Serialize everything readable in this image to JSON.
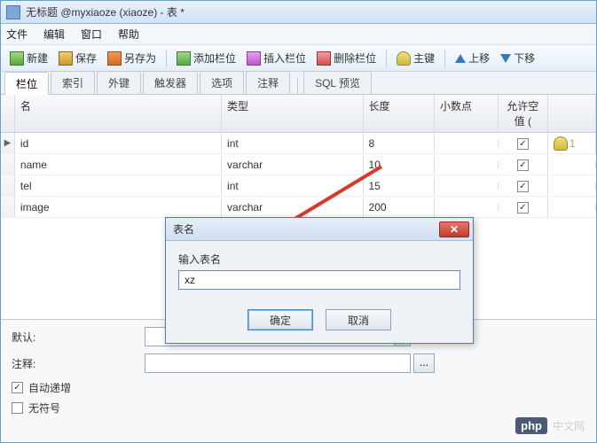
{
  "window": {
    "title": "无标题 @myxiaoze (xiaoze) - 表 *"
  },
  "menu": {
    "file": "文件",
    "edit": "编辑",
    "window": "窗口",
    "help": "帮助"
  },
  "toolbar": {
    "new_label": "新建",
    "save_label": "保存",
    "saveas_label": "另存为",
    "addcol_label": "添加栏位",
    "inscol_label": "插入栏位",
    "delcol_label": "删除栏位",
    "pk_label": "主键",
    "up_label": "上移",
    "down_label": "下移"
  },
  "tabs": {
    "fields": "栏位",
    "indexes": "索引",
    "fk": "外键",
    "triggers": "触发器",
    "options": "选项",
    "comment": "注释",
    "preview": "SQL 预览"
  },
  "grid": {
    "head": {
      "name": "名",
      "type": "类型",
      "length": "长度",
      "decimal": "小数点",
      "nullable": "允许空值 (",
      "key": ""
    },
    "rows": [
      {
        "name": "id",
        "type": "int",
        "length": "8",
        "decimal": "",
        "nullable": true,
        "key": "1",
        "current": true
      },
      {
        "name": "name",
        "type": "varchar",
        "length": "10",
        "decimal": "",
        "nullable": true,
        "key": "",
        "current": false
      },
      {
        "name": "tel",
        "type": "int",
        "length": "15",
        "decimal": "",
        "nullable": true,
        "key": "",
        "current": false
      },
      {
        "name": "image",
        "type": "varchar",
        "length": "200",
        "decimal": "",
        "nullable": true,
        "key": "",
        "current": false
      }
    ]
  },
  "bottom": {
    "default_label": "默认:",
    "comment_label": "注释:",
    "autoinc_label": "自动递增",
    "autoinc_checked": true,
    "unsigned_label": "无符号",
    "unsigned_checked": false,
    "dots": "..."
  },
  "dialog": {
    "title": "表名",
    "prompt": "输入表名",
    "value": "xz",
    "ok": "确定",
    "cancel": "取消"
  },
  "watermark": {
    "badge": "php",
    "text": "中文网"
  }
}
